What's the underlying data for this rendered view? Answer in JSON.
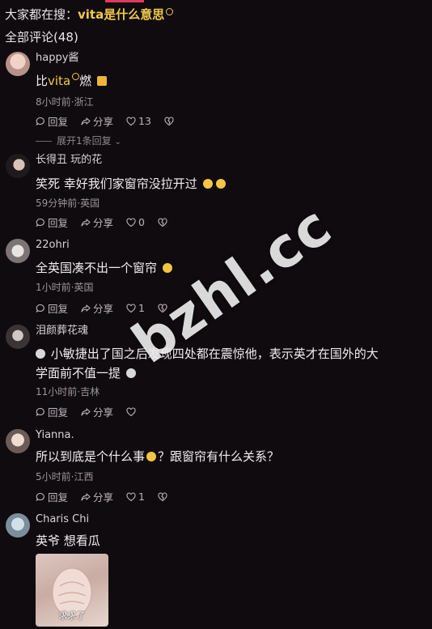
{
  "search": {
    "prefix": "大家都在搜：",
    "term": "vita是什么意思"
  },
  "comment_count": "全部评论(48)",
  "action_labels": {
    "reply": "回复",
    "share": "分享"
  },
  "comments": [
    {
      "username": "happy酱",
      "text_parts": [
        "比",
        "vita",
        "燃"
      ],
      "meta": "8小时前·浙江",
      "likes": "13",
      "expand": "展开1条回复"
    },
    {
      "username": "长得丑 玩的花",
      "text": "笑死 幸好我们家窗帘没拉开过",
      "meta": "59分钟前·英国",
      "likes": "0"
    },
    {
      "username": "22ohri",
      "text": "全英国凑不出一个窗帘",
      "meta": "1小时前·英国",
      "likes": "1"
    },
    {
      "username": "泪颜葬花魂",
      "text_a": "小敏捷出了国之后发现四处都在震惊他，表示英才在国外的大",
      "text_b": "学面前不值一提",
      "meta": "11小时前·吉林",
      "likes": ""
    },
    {
      "username": "Yianna.",
      "text_a": "所以到底是个什么事",
      "text_b": "？跟窗帘有什么关系？",
      "meta": "5小时前·江西",
      "likes": "1"
    },
    {
      "username": "Charis Chi",
      "text": "英爷 想看瓜",
      "image_caption": "求求了"
    }
  ],
  "watermark": "bzhl.cc",
  "colors": {
    "background": "#0f0b0e",
    "accent": "#f2c94c",
    "top_indicator": "#e03a5a"
  }
}
